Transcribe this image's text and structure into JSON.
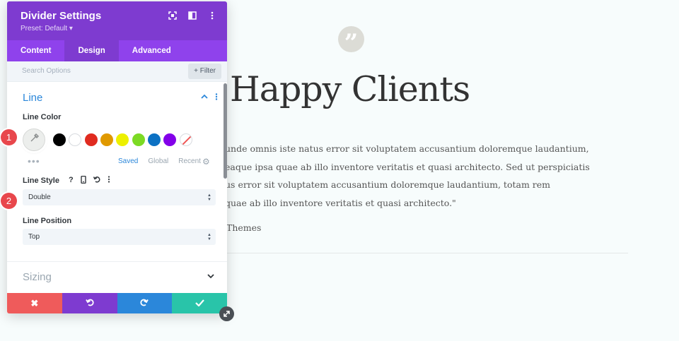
{
  "page": {
    "title": "Happy Clients",
    "paragraph_lines": [
      "unde omnis iste natus error sit voluptatem accusantium doloremque laudantium,",
      "eaque ipsa quae ab illo inventore veritatis et quasi architecto. Sed ut perspiciatis",
      "us error sit voluptatem accusantium doloremque laudantium, totam rem",
      "quae ab illo inventore veritatis et quasi architecto.\""
    ],
    "author": "Themes"
  },
  "panel": {
    "title": "Divider Settings",
    "preset": "Preset: Default ▾",
    "tabs": [
      {
        "label": "Content"
      },
      {
        "label": "Design"
      },
      {
        "label": "Advanced"
      }
    ],
    "active_tab": "Design",
    "search": {
      "placeholder": "Search Options"
    },
    "filter_label": "+ Filter",
    "section_line": {
      "title": "Line",
      "line_color_label": "Line Color",
      "swatches": [
        "#000000",
        "#ffffff",
        "#e02b20",
        "#e09900",
        "#edf000",
        "#7cda24",
        "#0c71c3",
        "#8300e9"
      ],
      "swatch_tabs": [
        "Saved",
        "Global",
        "Recent"
      ],
      "active_swatch_tab": "Saved",
      "line_style_label": "Line Style",
      "line_style_value": "Double",
      "line_position_label": "Line Position",
      "line_position_value": "Top"
    },
    "section_sizing": {
      "title": "Sizing"
    },
    "footer_colors": [
      "#ef5b5b",
      "#7e3bd0",
      "#2b87da",
      "#29c4a9"
    ]
  },
  "badges": [
    "1",
    "2"
  ],
  "colors": {
    "header_purple": "#7e3bd0",
    "tab_purple": "#8f42ec",
    "accent_blue": "#2b87da"
  }
}
